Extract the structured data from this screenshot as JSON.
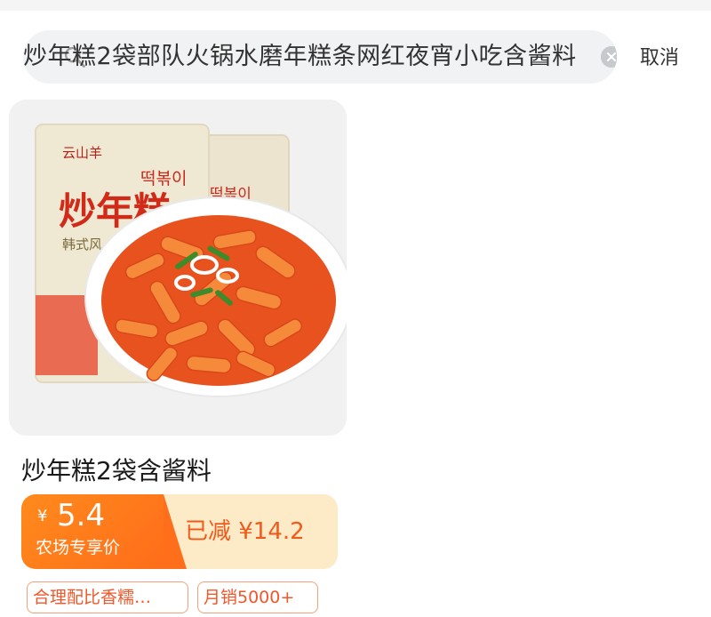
{
  "search": {
    "query": "炒年糕2袋部队火锅水磨年糕条网红夜宵小吃含酱料",
    "cancel_label": "取消"
  },
  "product": {
    "image_label": "炒年糕",
    "title": "炒年糕2袋含酱料",
    "price": {
      "currency": "¥",
      "value": "5.4",
      "caption": "农场专享价",
      "discount": "已减 ¥14.2"
    },
    "tags": [
      "合理配比香糯…",
      "月销5000+"
    ]
  },
  "colors": {
    "accent_orange": "#ff7a1a",
    "discount_bg": "#fdebc8",
    "tag_red": "#f0572a"
  }
}
